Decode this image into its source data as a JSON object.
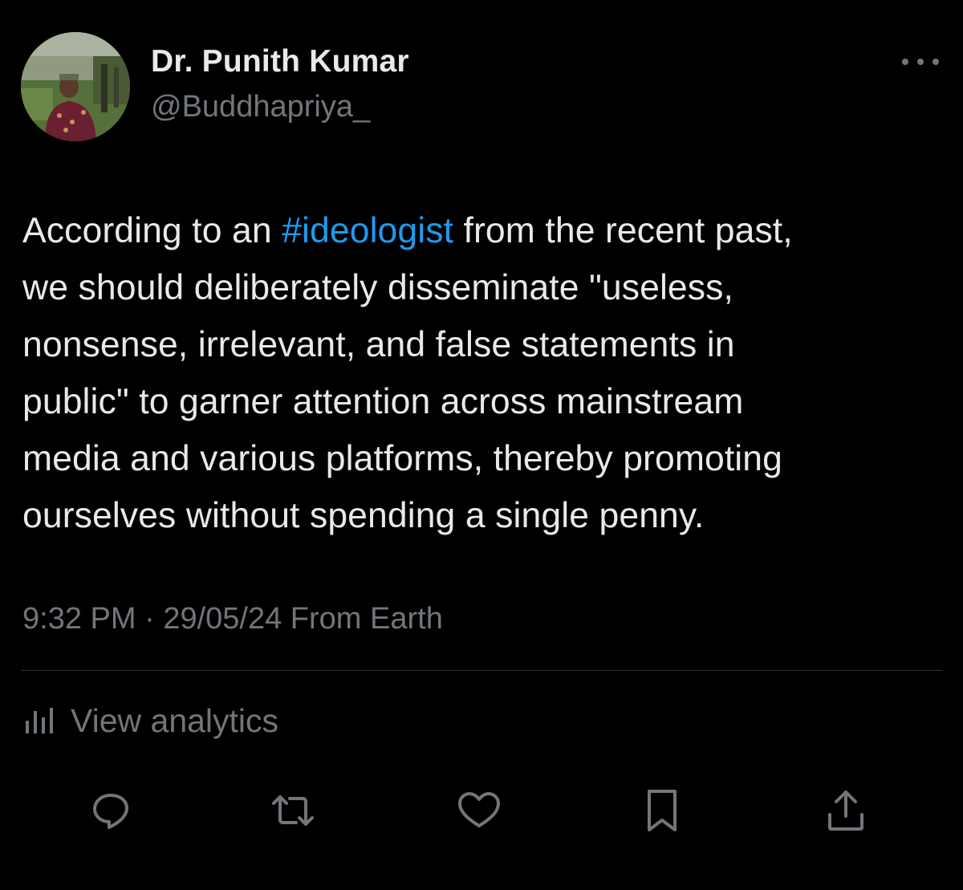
{
  "author": {
    "name": "Dr. Punith Kumar",
    "handle": "@Buddhapriya_"
  },
  "tweet": {
    "line1_before": "According to an ",
    "hashtag": "#ideologist",
    "line1_after": " from the recent past,",
    "line2": "we should deliberately disseminate \"useless,",
    "line3": "nonsense, irrelevant, and false statements in",
    "line4": "public\" to garner attention across mainstream",
    "line5": "media and various platforms, thereby promoting",
    "line6": "ourselves without spending a single penny."
  },
  "meta": {
    "time": "9:32 PM",
    "separator": " · ",
    "date": "29/05/24",
    "source": " From Earth"
  },
  "analytics": {
    "label": "View analytics",
    "icon": "bar-chart-icon"
  },
  "actions": {
    "icons": [
      "reply-icon",
      "retweet-icon",
      "like-icon",
      "bookmark-icon",
      "share-icon"
    ]
  },
  "colors": {
    "background": "#000000",
    "text": "#e7e9ea",
    "secondary": "#71767b",
    "accent": "#1d9bf0",
    "divider": "#2f3336"
  }
}
